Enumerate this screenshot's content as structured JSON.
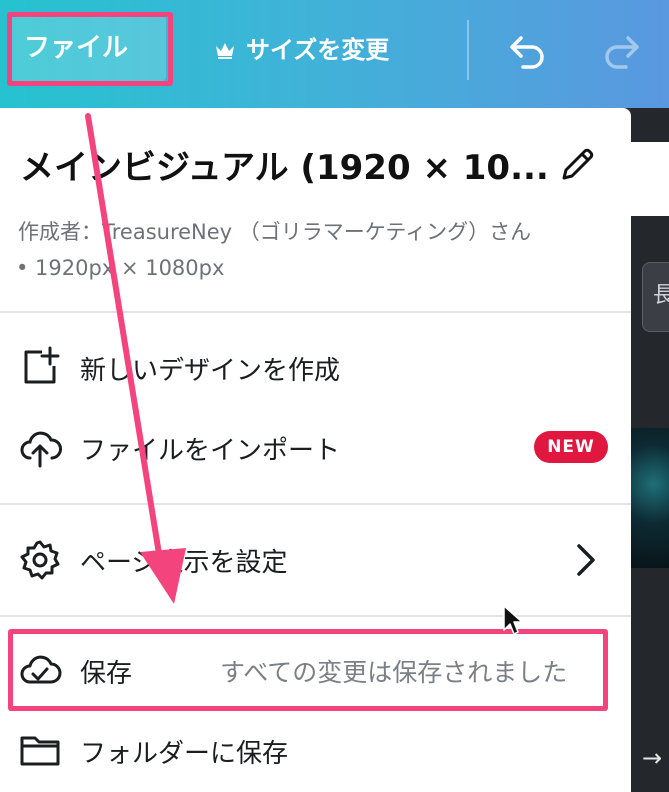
{
  "topbar": {
    "file_label": "ファイル",
    "resize_label": "サイズを変更",
    "crown_icon": "crown-icon",
    "undo_icon": "undo-icon",
    "redo_icon": "redo-icon"
  },
  "menu": {
    "title": "メインビジュアル (1920 × 10...",
    "author": "作成者：TreasureNey （ゴリラマーケティング）さん",
    "dimensions": "• 1920px × 1080px",
    "items": [
      {
        "label": "新しいデザインを作成",
        "icon": "new-design-icon"
      },
      {
        "label": "ファイルをインポート",
        "icon": "cloud-upload-icon",
        "badge": "NEW"
      },
      {
        "label": "ページ表示を設定",
        "icon": "gear-icon"
      },
      {
        "label": "保存",
        "icon": "cloud-check-icon",
        "status": "すべての変更は保存されました"
      },
      {
        "label": "フォルダーに保存",
        "icon": "folder-icon"
      }
    ]
  },
  "background": {
    "chip_text": "長"
  },
  "colors": {
    "accent_highlight": "#f3447d",
    "badge_red": "#e0173f",
    "topbar_start": "#26c2cf",
    "topbar_end": "#5a98e0"
  }
}
